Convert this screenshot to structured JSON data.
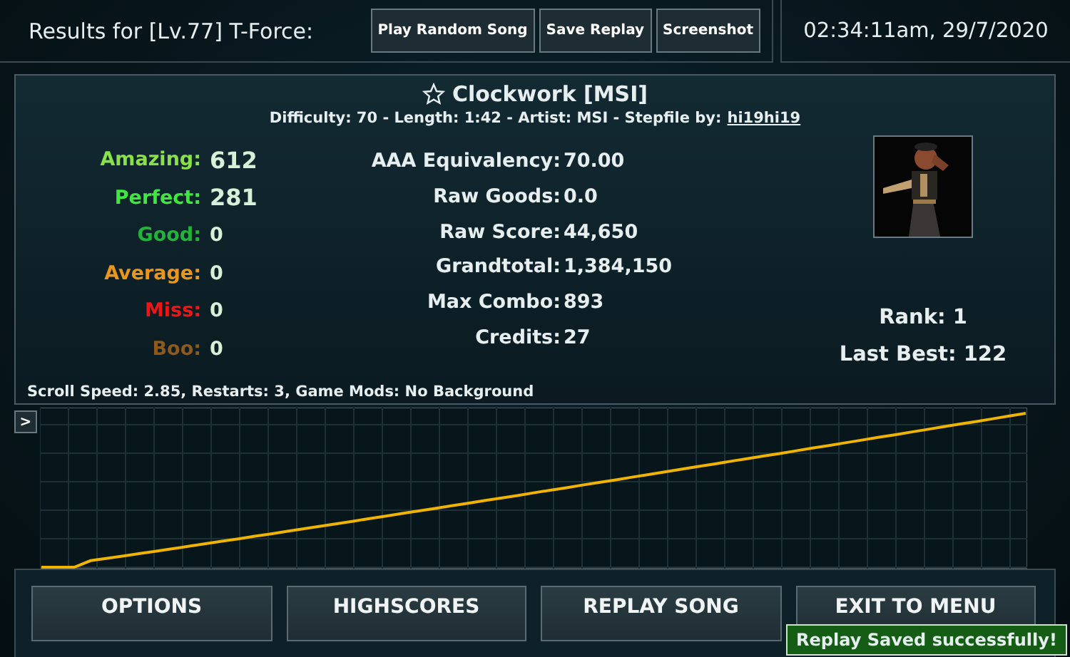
{
  "header": {
    "title": "Results for [Lv.77] T-Force:",
    "buttons": [
      "Play Random Song",
      "Save Replay",
      "Screenshot"
    ],
    "clock": "02:34:11am, 29/7/2020"
  },
  "song": {
    "title": "Clockwork [MSI]",
    "favorite": false,
    "info": "Difficulty: 70 - Length: 1:42 - Artist: MSI - Stepfile by:",
    "stepfile_author": "hi19hi19"
  },
  "judgements": [
    {
      "label": "Amazing:",
      "value": "612",
      "color": "#8ae04a"
    },
    {
      "label": "Perfect:",
      "value": "281",
      "color": "#3ee83e"
    },
    {
      "label": "Good:",
      "value": "0",
      "color": "#22b43a"
    },
    {
      "label": "Average:",
      "value": "0",
      "color": "#e8961e"
    },
    {
      "label": "Miss:",
      "value": "0",
      "color": "#f01414"
    },
    {
      "label": "Boo:",
      "value": "0",
      "color": "#8c5a1e"
    }
  ],
  "stats": [
    {
      "label": "AAA Equivalency:",
      "value": "70.00"
    },
    {
      "label": "Raw Goods:",
      "value": "0.0"
    },
    {
      "label": "Raw Score:",
      "value": "44,650"
    },
    {
      "label": "Grandtotal:",
      "value": "1,384,150"
    },
    {
      "label": "Max Combo:",
      "value": "893"
    },
    {
      "label": "Credits:",
      "value": "27"
    }
  ],
  "player": {
    "rank": "Rank: 1",
    "last_best": "Last Best: 122"
  },
  "settings_line": "Scroll Speed: 2.85, Restarts: 3, Game Mods: No Background",
  "graph": {
    "toggle": ">"
  },
  "bottom_buttons": [
    "OPTIONS",
    "HIGHSCORES",
    "REPLAY SONG",
    "EXIT TO MENU"
  ],
  "toast": "Replay Saved successfully!"
}
